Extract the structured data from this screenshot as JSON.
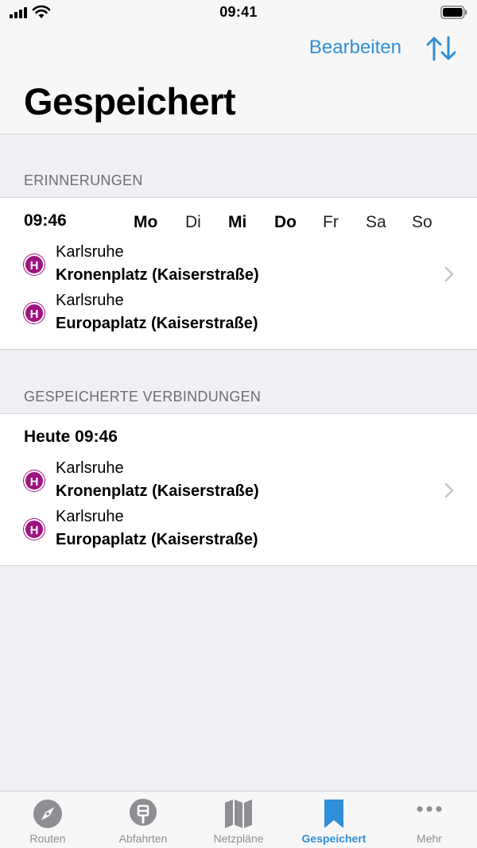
{
  "status": {
    "time": "09:41"
  },
  "nav": {
    "edit_label": "Bearbeiten",
    "title": "Gespeichert"
  },
  "reminders": {
    "header": "ERINNERUNGEN",
    "time": "09:46",
    "weekdays": [
      {
        "label": "Mo",
        "active": true
      },
      {
        "label": "Di",
        "active": false
      },
      {
        "label": "Mi",
        "active": true
      },
      {
        "label": "Do",
        "active": true
      },
      {
        "label": "Fr",
        "active": false
      },
      {
        "label": "Sa",
        "active": false
      },
      {
        "label": "So",
        "active": false
      }
    ],
    "stops": [
      {
        "badge": "H",
        "city": "Karlsruhe",
        "name": "Kronenplatz (Kaiserstraße)"
      },
      {
        "badge": "H",
        "city": "Karlsruhe",
        "name": "Europaplatz (Kaiserstraße)"
      }
    ]
  },
  "saved": {
    "header": "GESPEICHERTE VERBINDUNGEN",
    "time": "Heute 09:46",
    "stops": [
      {
        "badge": "H",
        "city": "Karlsruhe",
        "name": "Kronenplatz (Kaiserstraße)"
      },
      {
        "badge": "H",
        "city": "Karlsruhe",
        "name": "Europaplatz (Kaiserstraße)"
      }
    ]
  },
  "tabs": [
    {
      "label": "Routen",
      "icon": "compass-icon",
      "active": false
    },
    {
      "label": "Abfahrten",
      "icon": "stop-sign-icon",
      "active": false
    },
    {
      "label": "Netzpläne",
      "icon": "map-icon",
      "active": false
    },
    {
      "label": "Gespeichert",
      "icon": "bookmark-icon",
      "active": true
    },
    {
      "label": "Mehr",
      "icon": "more-icon",
      "active": false
    }
  ],
  "colors": {
    "accent": "#2f8fd8",
    "stop_badge": "#a0127f",
    "background": "#efeff4"
  }
}
